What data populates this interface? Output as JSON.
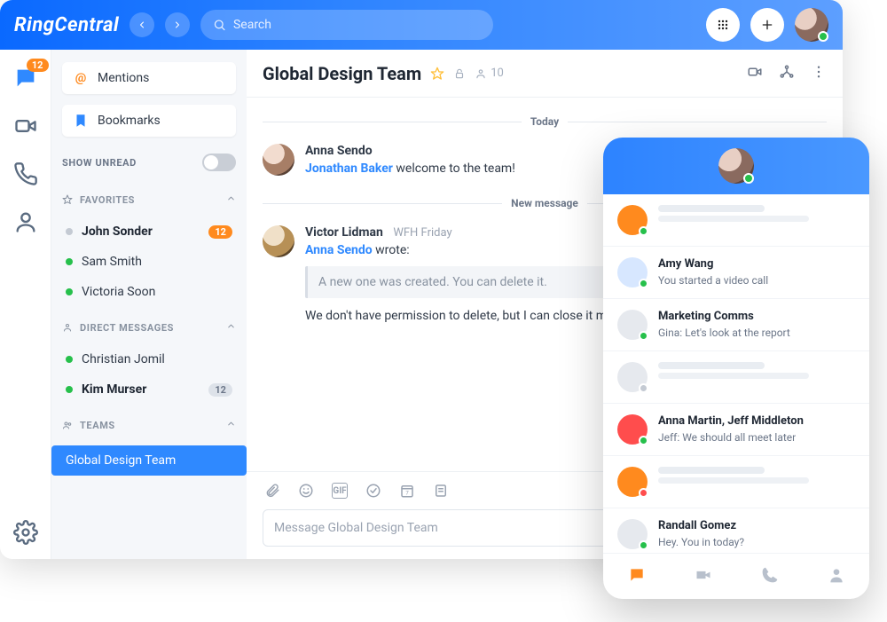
{
  "brand": "RingCentral",
  "search_placeholder": "Search",
  "rail": {
    "msg_badge": "12"
  },
  "sidebar": {
    "mentions": "Mentions",
    "bookmarks": "Bookmarks",
    "show_unread": "SHOW UNREAD",
    "favorites_hd": "FAVORITES",
    "dm_hd": "DIRECT MESSAGES",
    "teams_hd": "TEAMS",
    "favorites": [
      {
        "name": "John Sonder",
        "bold": true,
        "badge": "12"
      },
      {
        "name": "Sam Smith"
      },
      {
        "name": "Victoria Soon"
      }
    ],
    "dms": [
      {
        "name": "Christian Jomil"
      },
      {
        "name": "Kim Murser",
        "bold": true,
        "badge_gray": "12"
      }
    ],
    "teams": [
      {
        "name": "Global Design Team",
        "active": true
      }
    ]
  },
  "chat": {
    "title": "Global Design Team",
    "member_count": "10",
    "today_divider": "Today",
    "new_msg_divider": "New message",
    "msg1_name": "Anna Sendo",
    "msg1_link": "Jonathan Baker",
    "msg1_text": " welcome to the team!",
    "msg2_name": "Victor Lidman",
    "msg2_sub": "WFH Friday",
    "msg2_link": "Anna Sendo",
    "msg2_wrote": " wrote:",
    "msg2_quote": "A new one was created. You can delete it.",
    "msg2_text": "We don't have permission to delete, but I can close it manually.",
    "composer_placeholder": "Message Global Design Team"
  },
  "mobile": {
    "items": [
      {
        "color": "#ff8a1e",
        "dot": "#26c04b",
        "skeleton": true
      },
      {
        "color": "#d7e7ff",
        "dot": "#26c04b",
        "name": "Amy Wang",
        "sub": "You started a video call"
      },
      {
        "color": "#e6e9ee",
        "dot": "#26c04b",
        "name": "Marketing Comms",
        "sub": "Gina: Let's look at the report"
      },
      {
        "color": "#e6e9ee",
        "dot": "#c4cad3",
        "skeleton": true
      },
      {
        "color": "#ff4d4d",
        "dot": "#26c04b",
        "name": "Anna Martin, Jeff Middleton",
        "sub": "Jeff: We should all meet later"
      },
      {
        "color": "#ff8a1e",
        "dot": "#ff4d4d",
        "skeleton": true
      },
      {
        "color": "#e6e9ee",
        "dot": "#26c04b",
        "name": "Randall Gomez",
        "sub": "Hey. You in today?"
      }
    ]
  }
}
